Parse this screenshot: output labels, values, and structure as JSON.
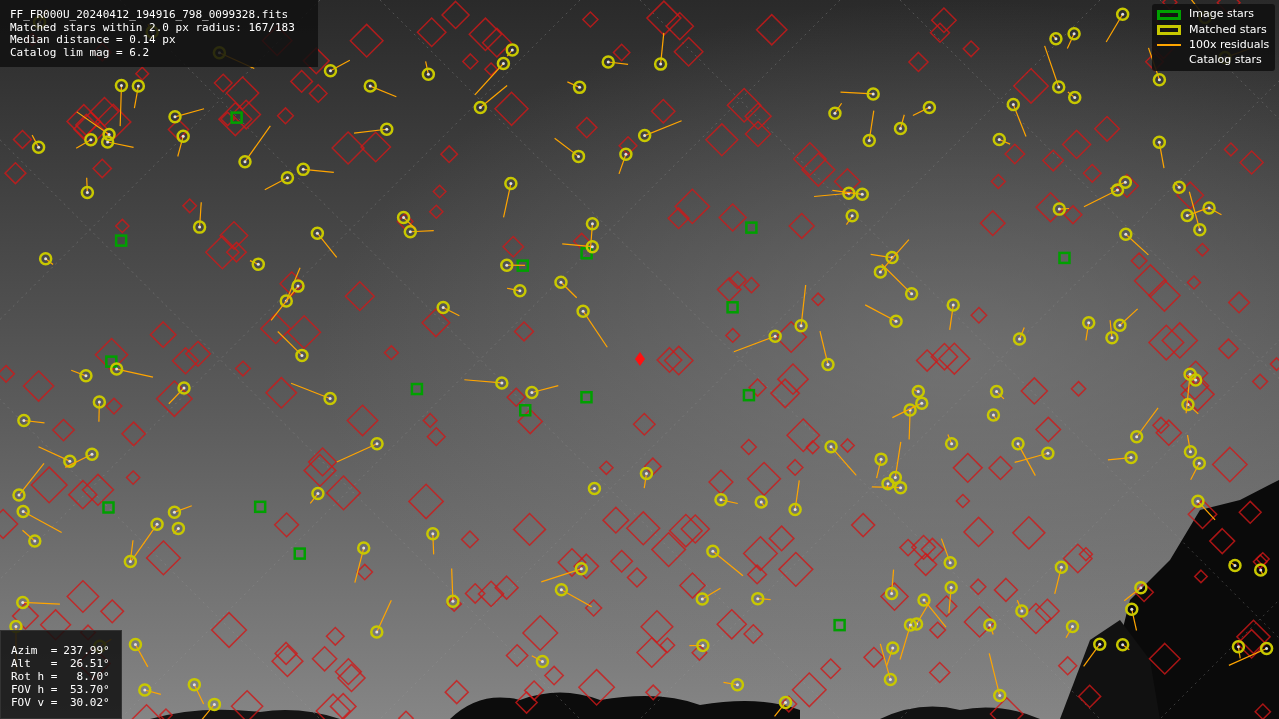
{
  "info": {
    "lines": [
      "FF_FR000U_20240412_194916_798_0099328.fits",
      "Matched stars within 2.0 px radius: 167/183",
      "Median distance = 0.14 px",
      "Catalog lim mag = 6.2"
    ]
  },
  "legend": [
    {
      "label": "Image stars",
      "kind": "box",
      "color": "#00a000"
    },
    {
      "label": "Matched stars",
      "kind": "box",
      "color": "#c8c800"
    },
    {
      "label": "100x residuals",
      "kind": "line",
      "color": "#ffa500"
    },
    {
      "label": "Catalog stars",
      "kind": "none"
    }
  ],
  "pointing": [
    {
      "label": "Azim  =",
      "value": "237.99°"
    },
    {
      "label": "Alt   =",
      "value": " 26.51°"
    },
    {
      "label": "Rot h =",
      "value": "  8.70°"
    },
    {
      "label": "FOV h =",
      "value": " 53.70°"
    },
    {
      "label": "FOV v =",
      "value": " 30.02°"
    }
  ]
}
